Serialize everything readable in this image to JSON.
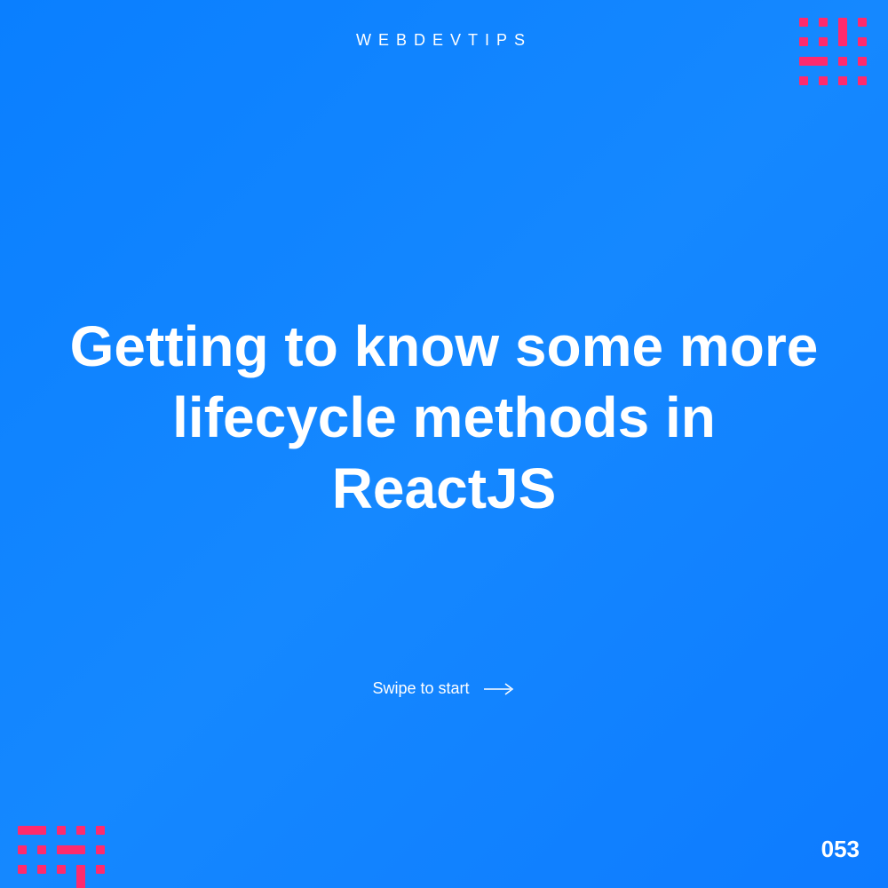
{
  "header": {
    "brand": "WEBDEVTIPS"
  },
  "main": {
    "title": "Getting to know some more lifecycle methods in ReactJS",
    "swipe_text": "Swipe to start"
  },
  "footer": {
    "page_number": "053"
  },
  "colors": {
    "background": "#0d7bff",
    "accent": "#ff2a6d",
    "text": "#ffffff"
  }
}
